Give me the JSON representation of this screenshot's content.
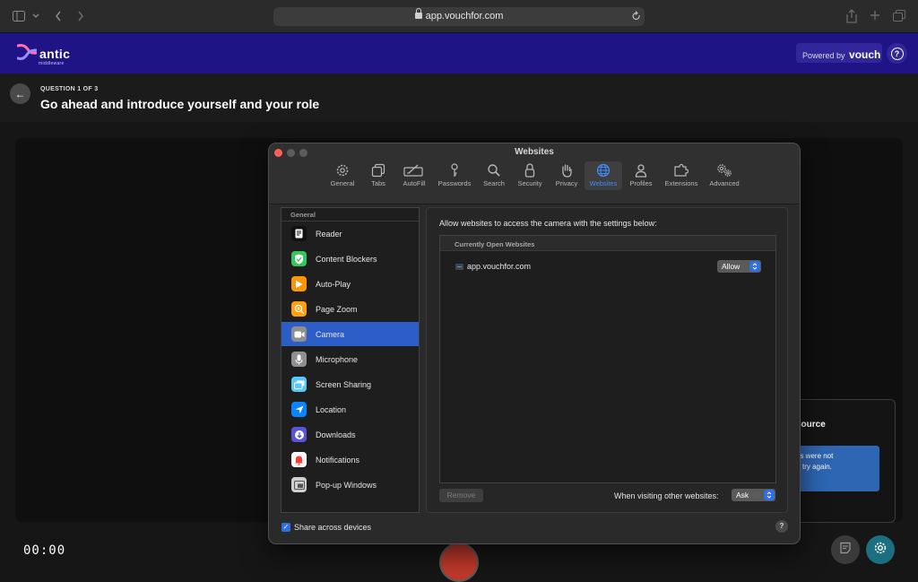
{
  "browser": {
    "url": "app.vouchfor.com",
    "icons": [
      "sidebar-icon",
      "chevron-down-icon",
      "back-icon",
      "forward-icon",
      "lock-icon",
      "reload-icon",
      "share-icon",
      "new-tab-icon",
      "tabs-overview-icon"
    ]
  },
  "site_header": {
    "logo_text": "antic",
    "logo_subtext": "middleware",
    "powered_prefix": "Powered by",
    "powered_brand": "vouch",
    "help_icon": "?"
  },
  "question": {
    "counter": "QUESTION 1 OF 3",
    "title": "Go ahead and introduce yourself and your role",
    "back_icon": "←"
  },
  "recorder": {
    "timer": "00:00",
    "error_title_fragment": "source",
    "error_line1": "ns were not",
    "error_line2": "try again."
  },
  "prefs": {
    "window_title": "Websites",
    "tabs": [
      {
        "label": "General",
        "icon": "gear-icon"
      },
      {
        "label": "Tabs",
        "icon": "tabs-icon"
      },
      {
        "label": "AutoFill",
        "icon": "autofill-icon"
      },
      {
        "label": "Passwords",
        "icon": "key-icon"
      },
      {
        "label": "Search",
        "icon": "search-icon"
      },
      {
        "label": "Security",
        "icon": "lock-icon"
      },
      {
        "label": "Privacy",
        "icon": "hand-icon"
      },
      {
        "label": "Websites",
        "icon": "globe-icon"
      },
      {
        "label": "Profiles",
        "icon": "person-icon"
      },
      {
        "label": "Extensions",
        "icon": "puzzle-icon"
      },
      {
        "label": "Advanced",
        "icon": "gears-icon"
      }
    ],
    "active_tab": "Websites",
    "sidebar_heading": "General",
    "sidebar_items": [
      {
        "label": "Reader",
        "icon": "reader-icon",
        "color": "#1c1c1c"
      },
      {
        "label": "Content Blockers",
        "icon": "shield-check-icon",
        "color": "#34c759"
      },
      {
        "label": "Auto-Play",
        "icon": "play-icon",
        "color": "#ff9500"
      },
      {
        "label": "Page Zoom",
        "icon": "zoom-icon",
        "color": "#ff9f0a"
      },
      {
        "label": "Camera",
        "icon": "video-camera-icon",
        "color": "#8e8e93"
      },
      {
        "label": "Microphone",
        "icon": "microphone-icon",
        "color": "#8e8e93"
      },
      {
        "label": "Screen Sharing",
        "icon": "screen-sharing-icon",
        "color": "#5ac8fa"
      },
      {
        "label": "Location",
        "icon": "location-arrow-icon",
        "color": "#0a84ff"
      },
      {
        "label": "Downloads",
        "icon": "download-icon",
        "color": "#5856d6"
      },
      {
        "label": "Notifications",
        "icon": "bell-icon",
        "color": "#ff3b30"
      },
      {
        "label": "Pop-up Windows",
        "icon": "popup-window-icon",
        "color": "#8e8e93"
      }
    ],
    "active_item": "Camera",
    "content": {
      "description": "Allow websites to access the camera with the settings below:",
      "table_header": "Currently Open Websites",
      "site_name": "app.vouchfor.com",
      "site_setting": "Allow",
      "remove_label": "Remove",
      "other_label": "When visiting other websites:",
      "other_setting": "Ask"
    },
    "share_label": "Share across devices",
    "share_checked": true,
    "help_label": "?"
  },
  "colors": {
    "brand_header": "#1f1486",
    "accent_blue": "#2d5ec8",
    "record_red": "#c0392b",
    "settings_teal": "#1b6f80"
  }
}
